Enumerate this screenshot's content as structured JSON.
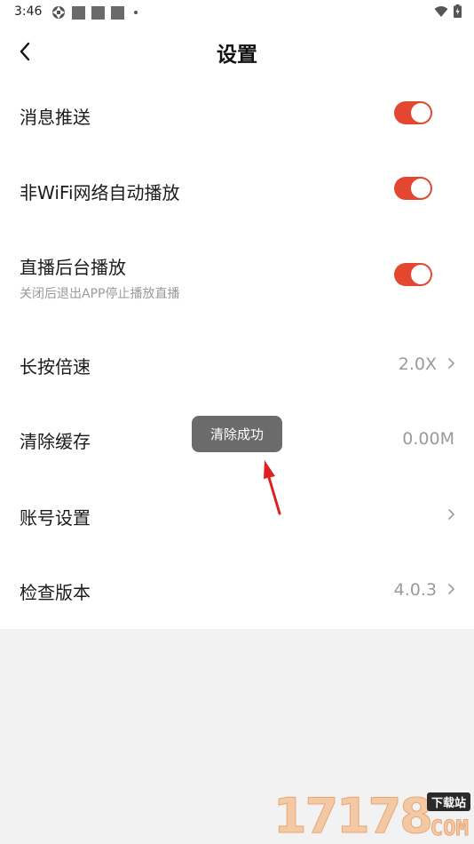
{
  "status_bar": {
    "time": "3:46"
  },
  "header": {
    "title": "设置"
  },
  "settings": {
    "push": {
      "label": "消息推送",
      "enabled": true
    },
    "wifi_autoplay": {
      "label": "非WiFi网络自动播放",
      "enabled": true
    },
    "background_play": {
      "label": "直播后台播放",
      "sub": "关闭后退出APP停止播放直播",
      "enabled": true
    },
    "long_press_speed": {
      "label": "长按倍速",
      "value": "2.0X"
    },
    "clear_cache": {
      "label": "清除缓存",
      "value": "0.00M"
    },
    "account": {
      "label": "账号设置"
    },
    "check_version": {
      "label": "检查版本",
      "value": "4.0.3"
    }
  },
  "toast": {
    "text": "清除成功"
  },
  "watermark": {
    "digits": "17178",
    "tag": "下载站",
    "domain": "COM"
  },
  "colors": {
    "accent": "#e4472f",
    "toast_bg": "#6b6b6b",
    "annotation_arrow": "#e02020"
  }
}
